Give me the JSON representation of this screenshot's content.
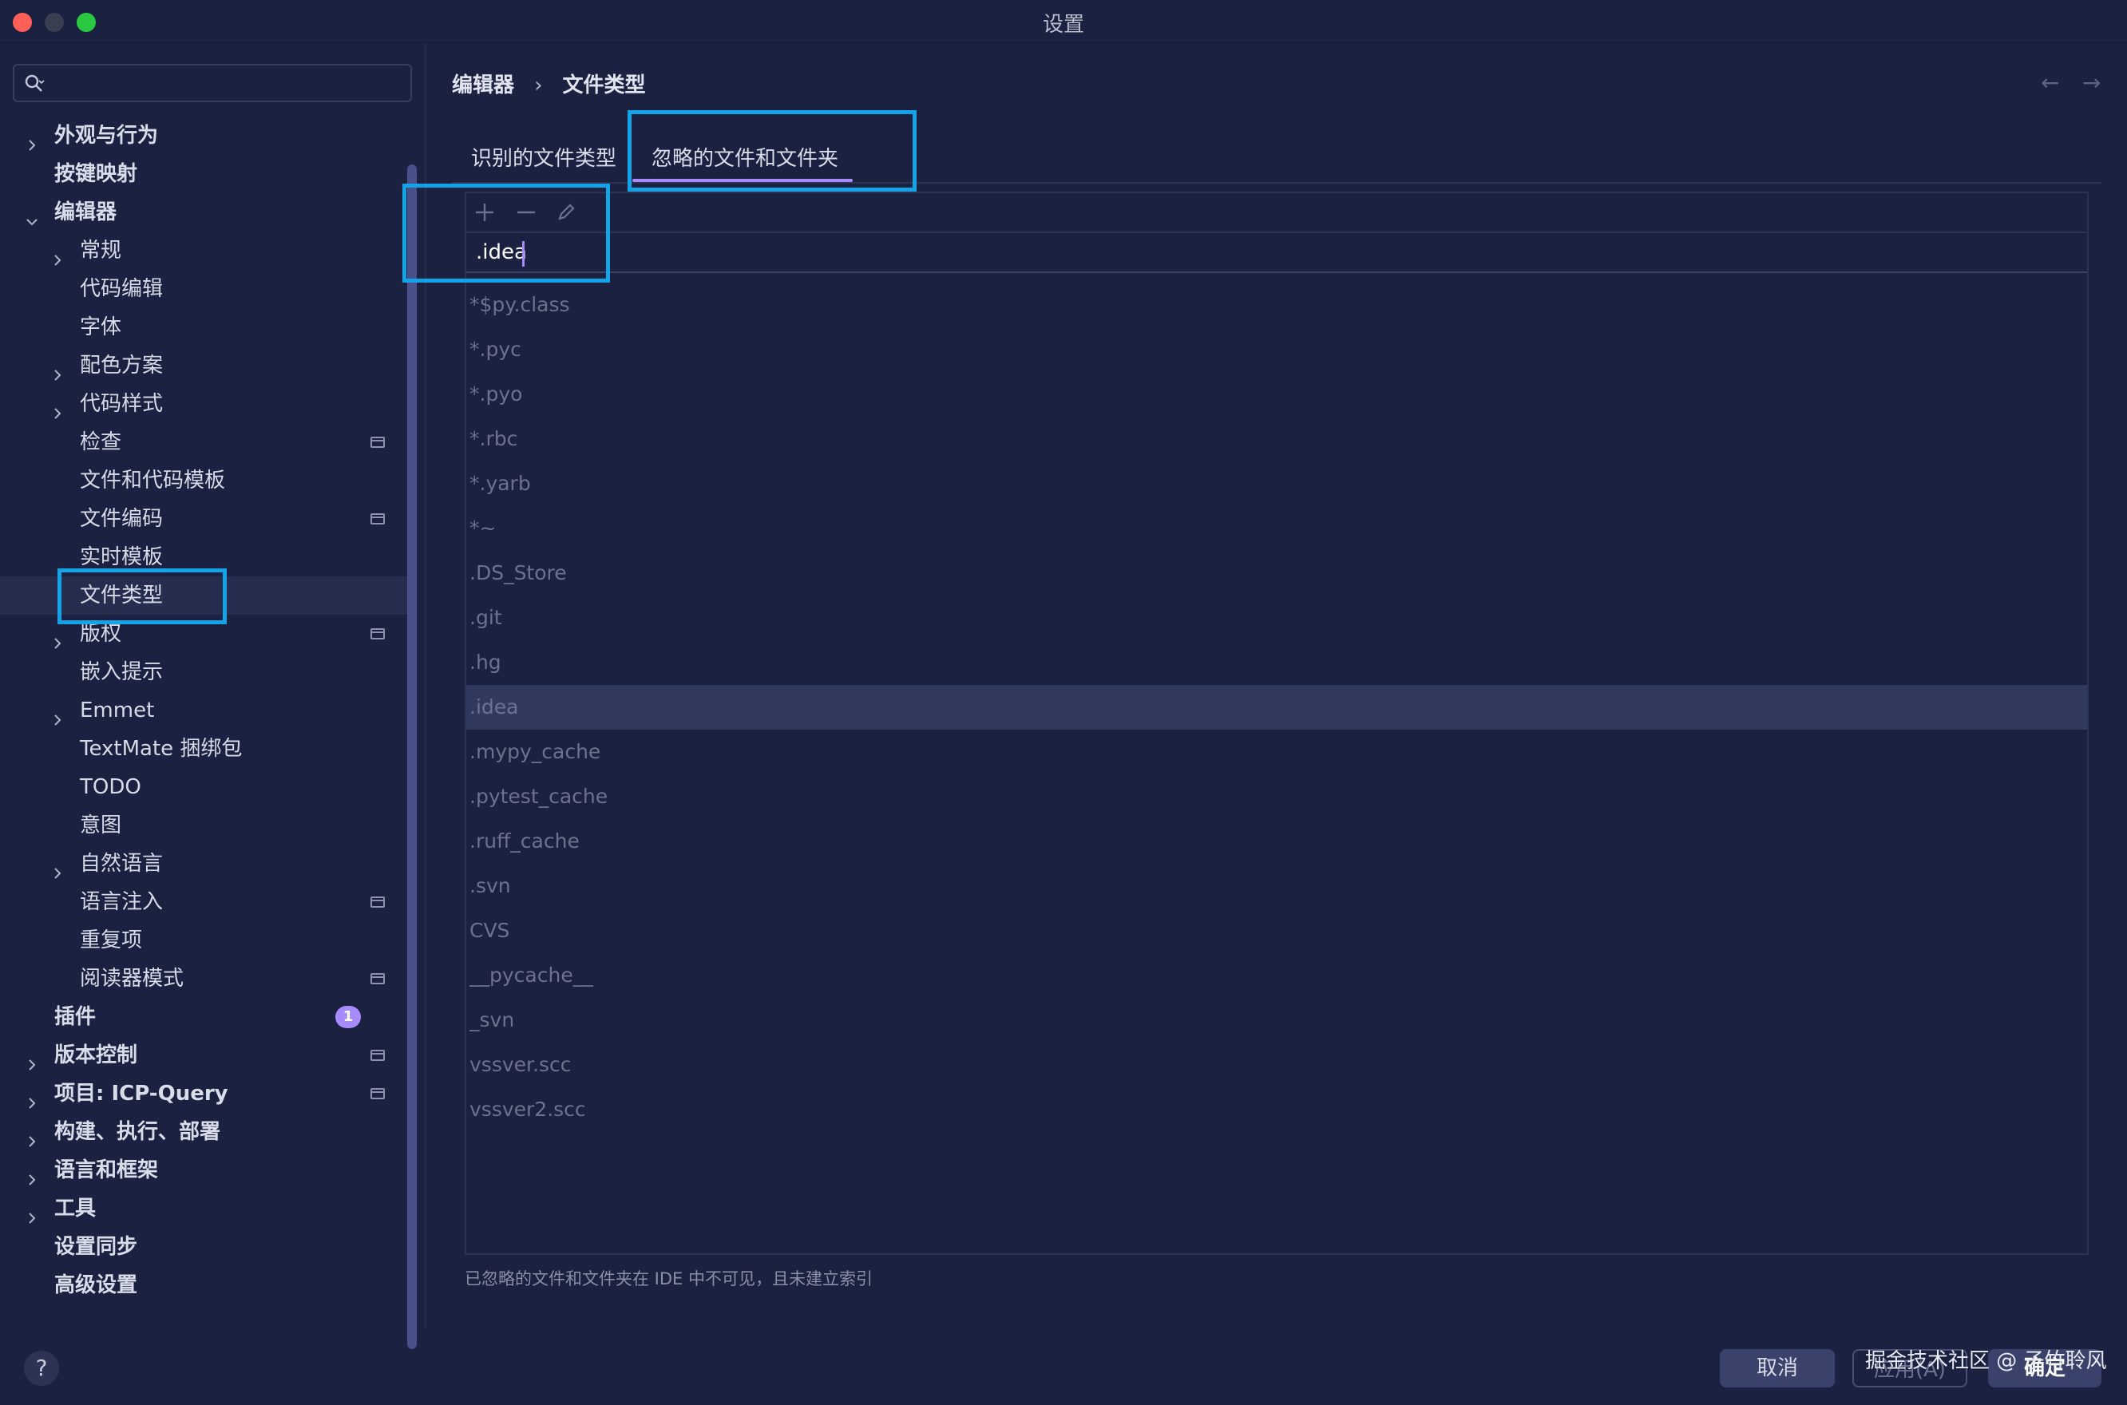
{
  "window": {
    "title": "设置"
  },
  "search": {
    "value": "",
    "placeholder": ""
  },
  "sidebar": {
    "items": [
      {
        "label": "外观与行为",
        "level": 0,
        "chevron": "right"
      },
      {
        "label": "按键映射",
        "level": 0
      },
      {
        "label": "编辑器",
        "level": 0,
        "chevron": "down"
      },
      {
        "label": "常规",
        "level": 1,
        "chevron": "right"
      },
      {
        "label": "代码编辑",
        "level": 1
      },
      {
        "label": "字体",
        "level": 1
      },
      {
        "label": "配色方案",
        "level": 1,
        "chevron": "right"
      },
      {
        "label": "代码样式",
        "level": 1,
        "chevron": "right"
      },
      {
        "label": "检查",
        "level": 1,
        "page_icon": true
      },
      {
        "label": "文件和代码模板",
        "level": 1
      },
      {
        "label": "文件编码",
        "level": 1,
        "page_icon": true
      },
      {
        "label": "实时模板",
        "level": 1
      },
      {
        "label": "文件类型",
        "level": 1,
        "selected": true
      },
      {
        "label": "版权",
        "level": 1,
        "chevron": "right",
        "page_icon": true
      },
      {
        "label": "嵌入提示",
        "level": 1
      },
      {
        "label": "Emmet",
        "level": 1,
        "chevron": "right"
      },
      {
        "label": "TextMate 捆绑包",
        "level": 1
      },
      {
        "label": "TODO",
        "level": 1
      },
      {
        "label": "意图",
        "level": 1
      },
      {
        "label": "自然语言",
        "level": 1,
        "chevron": "right"
      },
      {
        "label": "语言注入",
        "level": 1,
        "page_icon": true
      },
      {
        "label": "重复项",
        "level": 1
      },
      {
        "label": "阅读器模式",
        "level": 1,
        "page_icon": true
      },
      {
        "label": "插件",
        "level": 0,
        "badge": "1"
      },
      {
        "label": "版本控制",
        "level": 0,
        "chevron": "right",
        "page_icon": true
      },
      {
        "label": "项目: ICP-Query",
        "level": 0,
        "chevron": "right",
        "page_icon": true
      },
      {
        "label": "构建、执行、部署",
        "level": 0,
        "chevron": "right"
      },
      {
        "label": "语言和框架",
        "level": 0,
        "chevron": "right"
      },
      {
        "label": "工具",
        "level": 0,
        "chevron": "right"
      },
      {
        "label": "设置同步",
        "level": 0
      },
      {
        "label": "高级设置",
        "level": 0
      }
    ]
  },
  "breadcrumb": {
    "parent": "编辑器",
    "separator": "›",
    "current": "文件类型"
  },
  "nav": {
    "back": "←",
    "forward": "→"
  },
  "tabs": [
    {
      "label": "识别的文件类型",
      "active": false
    },
    {
      "label": "忽略的文件和文件夹",
      "active": true
    }
  ],
  "toolbar": {
    "add": "add-icon",
    "remove": "remove-icon",
    "edit": "edit-icon"
  },
  "editor": {
    "value": ".idea"
  },
  "patterns": [
    "*$py.class",
    "*.pyc",
    "*.pyo",
    "*.rbc",
    "*.yarb",
    "*~",
    ".DS_Store",
    ".git",
    ".hg",
    ".idea",
    ".mypy_cache",
    ".pytest_cache",
    ".ruff_cache",
    ".svn",
    "CVS",
    "__pycache__",
    "_svn",
    "vssver.scc",
    "vssver2.scc"
  ],
  "selected_pattern": ".idea",
  "hint": "已忽略的文件和文件夹在 IDE 中不可见，且未建立索引",
  "footer": {
    "help": "?",
    "cancel": "取消",
    "apply": "应用(A)",
    "ok": "确定"
  },
  "watermark": "掘金技术社区 @ 子竹聆风",
  "colors": {
    "background": "#1b2140",
    "accent": "#a78bfa",
    "highlight": "#14a3e6",
    "selection": "#313a5e"
  }
}
